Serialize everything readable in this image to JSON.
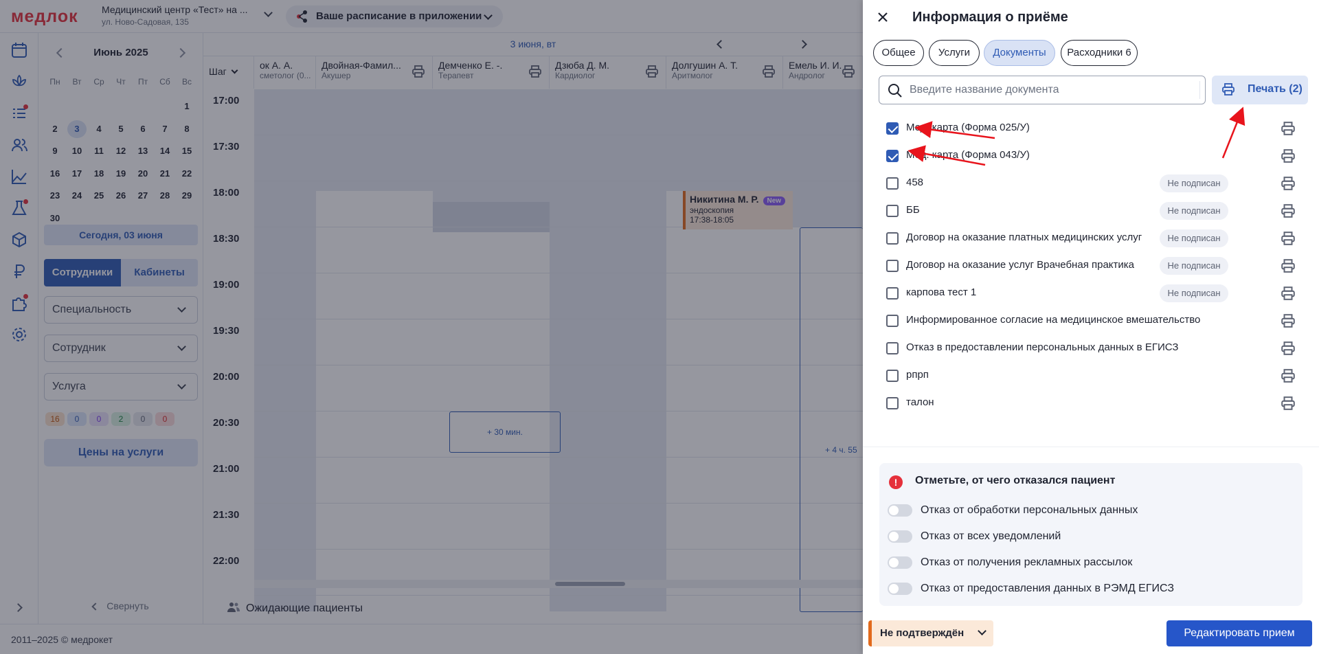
{
  "app": {
    "logo": "медлок",
    "clinic_name": "Медицинский центр «Тест» на ...",
    "clinic_address": "ул. Ново-Садовая, 135",
    "app_promo": "Ваше расписание в приложении",
    "footer": "2011–2025 © медрокет"
  },
  "sidebar": {
    "month": "Июнь 2025",
    "weekdays": [
      "Пн",
      "Вт",
      "Ср",
      "Чт",
      "Пт",
      "Сб",
      "Вс"
    ],
    "weeks": [
      [
        "",
        "",
        "",
        "",
        "",
        "",
        "1"
      ],
      [
        "2",
        "3",
        "4",
        "5",
        "6",
        "7",
        "8"
      ],
      [
        "9",
        "10",
        "11",
        "12",
        "13",
        "14",
        "15"
      ],
      [
        "16",
        "17",
        "18",
        "19",
        "20",
        "21",
        "22"
      ],
      [
        "23",
        "24",
        "25",
        "26",
        "27",
        "28",
        "29"
      ],
      [
        "30",
        "",
        "",
        "",
        "",
        "",
        ""
      ]
    ],
    "selected_day": "3",
    "today_label": "Сегодня, 03 июня",
    "segment_staff": "Сотрудники",
    "segment_rooms": "Кабинеты",
    "filter_specialty": "Специальность",
    "filter_employee": "Сотрудник",
    "filter_service": "Услуга",
    "chips": [
      "16",
      "0",
      "0",
      "2",
      "0",
      "0"
    ],
    "prices_button": "Цены на услуги",
    "collapse_label": "Свернуть"
  },
  "schedule": {
    "date": "3 июня, вт",
    "step_label": "Шаг",
    "columns": [
      {
        "name": "ок А. А.",
        "spec": "сметолог (0..."
      },
      {
        "name": "Двойная-Фамил...",
        "spec": "Акушер"
      },
      {
        "name": "Демченко Е. -.",
        "spec": "Терапевт"
      },
      {
        "name": "Дзюба Д. М.",
        "spec": "Кардиолог"
      },
      {
        "name": "Долгушин А. Т.",
        "spec": "Аритмолог"
      },
      {
        "name": "Емель И. И.",
        "spec": "Андролог"
      }
    ],
    "times": [
      "17:00",
      "17:30",
      "18:00",
      "18:30",
      "19:00",
      "19:30",
      "20:00",
      "20:30",
      "21:00",
      "21:30",
      "22:00"
    ],
    "appointment": {
      "patient": "Никитина М. Р.",
      "badge": "New",
      "service": "эндоскопия",
      "time": "17:38-18:05"
    },
    "slot_label": "+ 30 мин.",
    "slot_label_2": "+ 4 ч. 55",
    "waiting_label": "Ожидающие пациенты"
  },
  "drawer": {
    "title": "Информация о приёме",
    "tabs": [
      "Общее",
      "Услуги",
      "Документы",
      "Расходники 6"
    ],
    "active_tab": "Документы",
    "search_placeholder": "Введите название документа",
    "print_label": "Печать (2)",
    "not_signed": "Не подписан",
    "documents": [
      {
        "name": "Мед. карта (Форма 025/У)",
        "checked": true,
        "signed_badge": false
      },
      {
        "name": "Мед. карта (Форма 043/У)",
        "checked": true,
        "signed_badge": false
      },
      {
        "name": "458",
        "checked": false,
        "signed_badge": true
      },
      {
        "name": "ББ",
        "checked": false,
        "signed_badge": true
      },
      {
        "name": "Договор на оказание платных медицинских услуг",
        "checked": false,
        "signed_badge": true
      },
      {
        "name": "Договор на оказание услуг Врачебная практика",
        "checked": false,
        "signed_badge": true
      },
      {
        "name": "карпова тест 1",
        "checked": false,
        "signed_badge": true
      },
      {
        "name": "Информированное согласие на медицинское вмешательство",
        "checked": false,
        "signed_badge": false
      },
      {
        "name": "Отказ в предоставлении персональных данных в ЕГИСЗ",
        "checked": false,
        "signed_badge": false
      },
      {
        "name": "рпрп",
        "checked": false,
        "signed_badge": false
      },
      {
        "name": "талон",
        "checked": false,
        "signed_badge": false
      }
    ],
    "refusal_title": "Отметьте, от чего отказался пациент",
    "refusals": [
      "Отказ от обработки персональных данных",
      "Отказ от всех уведомлений",
      "Отказ от получения рекламных рассылок",
      "Отказ от предоставления данных в РЭМД ЕГИСЗ"
    ],
    "status": "Не подтверждён",
    "edit_button": "Редактировать прием"
  },
  "colors": {
    "accent": "#2f5bb4",
    "brand": "#e5303b",
    "status": "#e26a1c",
    "annotation_arrow": "#e8141c"
  }
}
